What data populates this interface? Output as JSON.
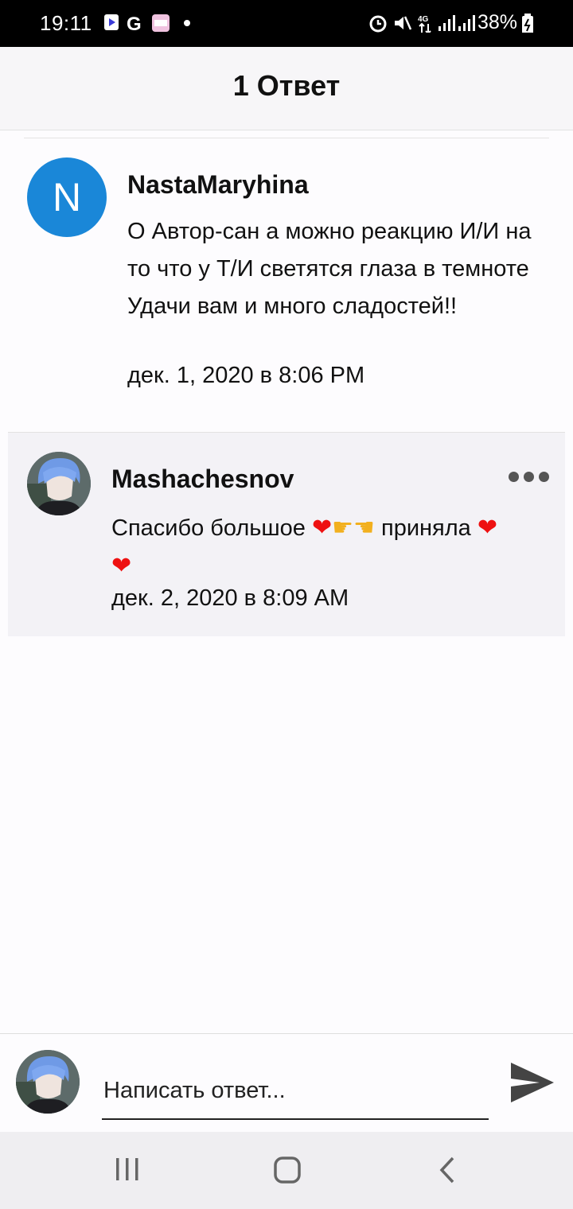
{
  "status_bar": {
    "time": "19:11",
    "battery": "38%",
    "network": "4G",
    "notification_icons": [
      "media-icon",
      "google-icon",
      "app-icon",
      "dot-icon"
    ],
    "system_icons": [
      "alarm-icon",
      "mute-icon",
      "data-icon",
      "signal-icon",
      "signal-icon",
      "battery-icon"
    ]
  },
  "header": {
    "title": "1 Ответ"
  },
  "comment": {
    "avatar_letter": "N",
    "avatar_color": "#1a87d8",
    "author": "NastaMaryhina",
    "text": "О Автор-сан а можно реакцию И/И на то что у Т/И светятся глаза в темноте\nУдачи вам и много сладостей!!",
    "date": "дек. 1, 2020 в 8:06 PM"
  },
  "reply": {
    "author": "Mashachesnov",
    "text_part1": "Спасибо большое",
    "text_part2": "приняла",
    "date": "дек. 2, 2020 в 8:09 AM",
    "more_icon": "more-horizontal-icon"
  },
  "composer": {
    "placeholder": "Написать ответ...",
    "send_icon": "send-icon"
  },
  "navbar": {
    "buttons": [
      "recent-apps-icon",
      "home-icon",
      "back-icon"
    ]
  }
}
